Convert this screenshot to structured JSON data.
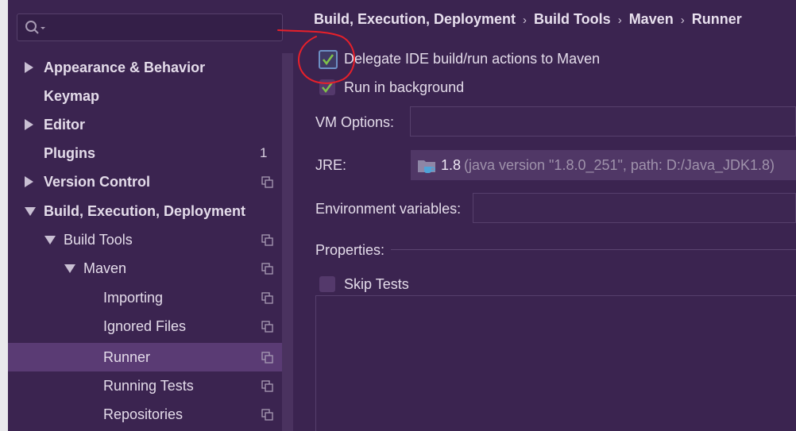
{
  "search": {
    "placeholder": ""
  },
  "sidebar": {
    "items": [
      {
        "label": "Appearance & Behavior",
        "count": ""
      },
      {
        "label": "Keymap",
        "count": ""
      },
      {
        "label": "Editor",
        "count": ""
      },
      {
        "label": "Plugins",
        "count": "1"
      },
      {
        "label": "Version Control",
        "count": ""
      },
      {
        "label": "Build, Execution, Deployment",
        "count": ""
      },
      {
        "label": "Build Tools",
        "count": ""
      },
      {
        "label": "Maven",
        "count": ""
      },
      {
        "label": "Importing",
        "count": ""
      },
      {
        "label": "Ignored Files",
        "count": ""
      },
      {
        "label": "Runner",
        "count": ""
      },
      {
        "label": "Running Tests",
        "count": ""
      },
      {
        "label": "Repositories",
        "count": ""
      }
    ]
  },
  "breadcrumb": [
    "Build, Execution, Deployment",
    "Build Tools",
    "Maven",
    "Runner"
  ],
  "runner": {
    "delegate_label": "Delegate IDE build/run actions to Maven",
    "delegate_checked": true,
    "background_label": "Run in background",
    "background_checked": true,
    "vm_options_label": "VM Options:",
    "vm_options_value": "",
    "jre_label": "JRE:",
    "jre_version": "1.8",
    "jre_detail": "(java version \"1.8.0_251\", path: D:/Java_JDK1.8)",
    "env_label": "Environment variables:",
    "env_value": "",
    "properties_label": "Properties:",
    "skip_tests_label": "Skip Tests",
    "skip_tests_checked": false
  },
  "colors": {
    "background": "#3b2450",
    "selection": "#5a3b74",
    "check_green": "#7fc24a",
    "annotation_red": "#e8202a"
  }
}
